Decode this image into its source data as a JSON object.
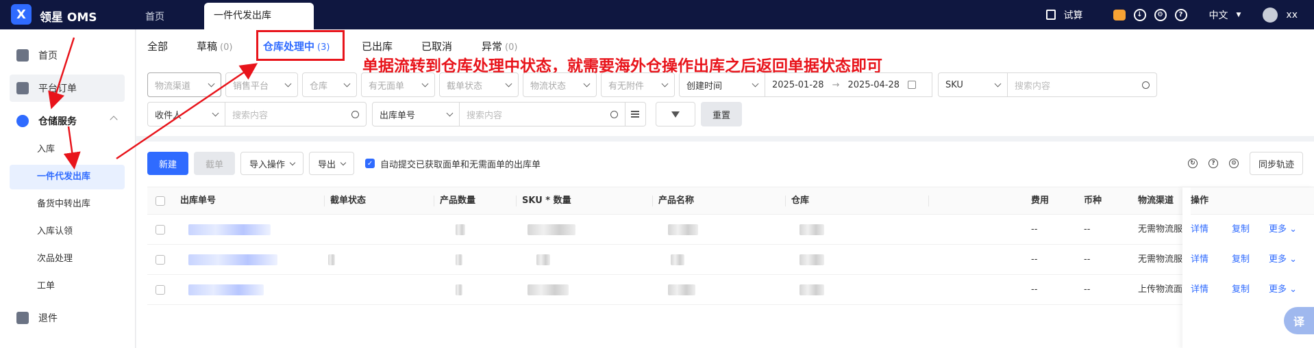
{
  "app": {
    "brand": "领星 OMS",
    "logo_text": "X"
  },
  "top_tabs": {
    "home": "首页",
    "active": "一件代发出库"
  },
  "top_right": {
    "trial": "试算",
    "lang": "中文",
    "user": "xx"
  },
  "sidebar": {
    "items": [
      {
        "label": "首页"
      },
      {
        "label": "平台订单"
      },
      {
        "label": "仓储服务"
      }
    ],
    "sub_items": [
      {
        "label": "入库"
      },
      {
        "label": "一件代发出库"
      },
      {
        "label": "备货中转出库"
      },
      {
        "label": "入库认领"
      },
      {
        "label": "次品处理"
      },
      {
        "label": "工单"
      }
    ],
    "bottom": {
      "label": "退件"
    }
  },
  "status_tabs": [
    {
      "label": "全部",
      "count": ""
    },
    {
      "label": "草稿",
      "count": "(0)"
    },
    {
      "label": "仓库处理中",
      "count": "(3)"
    },
    {
      "label": "已出库",
      "count": ""
    },
    {
      "label": "已取消",
      "count": ""
    },
    {
      "label": "异常",
      "count": "(0)"
    }
  ],
  "annotation": "单据流转到仓库处理中状态，就需要海外仓操作出库之后返回单据状态即可",
  "filters": {
    "channel": "物流渠道",
    "platform": "销售平台",
    "warehouse": "仓库",
    "has_label": "有无面单",
    "cut_status": "截单状态",
    "logistics_status": "物流状态",
    "has_attachment": "有无附件",
    "created_time": "创建时间",
    "date_start": "2025-01-28",
    "date_end": "2025-04-28",
    "sku": "SKU",
    "search_placeholder": "搜索内容",
    "receiver": "收件人",
    "receiver_placeholder": "搜索内容",
    "order_no": "出库单号",
    "order_placeholder": "搜索内容",
    "reset": "重置"
  },
  "toolbar": {
    "new": "新建",
    "cut": "截单",
    "import": "导入操作",
    "export": "导出",
    "auto_submit": "自动提交已获取面单和无需面单的出库单",
    "sync": "同步轨迹"
  },
  "table": {
    "headers": {
      "order_no": "出库单号",
      "cut_status": "截单状态",
      "product_qty": "产品数量",
      "sku_qty": "SKU * 数量",
      "product_name": "产品名称",
      "warehouse": "仓库",
      "fee": "费用",
      "currency": "币种",
      "channel": "物流渠道",
      "ops": "操作"
    },
    "rows": [
      {
        "fee": "--",
        "currency": "--",
        "channel": "无需物流服",
        "detail": "详情",
        "copy": "复制",
        "more": "更多"
      },
      {
        "fee": "--",
        "currency": "--",
        "channel": "无需物流服",
        "detail": "详情",
        "copy": "复制",
        "more": "更多"
      },
      {
        "fee": "--",
        "currency": "--",
        "channel": "上传物流面",
        "detail": "详情",
        "copy": "复制",
        "more": "更多"
      }
    ]
  },
  "translate_label": "译",
  "colors": {
    "primary": "#2f6bff",
    "topbar": "#0f1740",
    "annotation_red": "#e8141b"
  }
}
